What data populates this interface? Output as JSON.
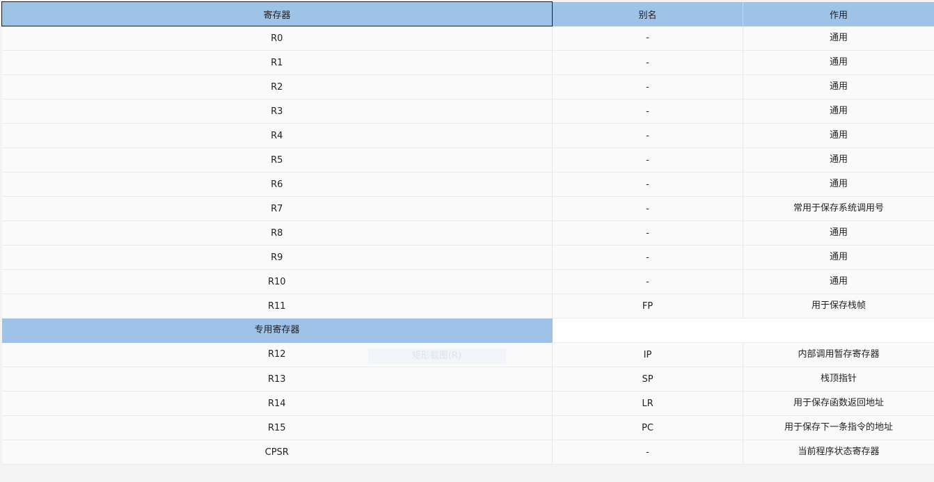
{
  "table": {
    "headers": {
      "register": "寄存器",
      "alias": "别名",
      "purpose": "作用"
    },
    "general_rows": [
      {
        "register": "R0",
        "alias": "-",
        "purpose": "通用"
      },
      {
        "register": "R1",
        "alias": "-",
        "purpose": "通用"
      },
      {
        "register": "R2",
        "alias": "-",
        "purpose": "通用"
      },
      {
        "register": "R3",
        "alias": "-",
        "purpose": "通用"
      },
      {
        "register": "R4",
        "alias": "-",
        "purpose": "通用"
      },
      {
        "register": "R5",
        "alias": "-",
        "purpose": "通用"
      },
      {
        "register": "R6",
        "alias": "-",
        "purpose": "通用"
      },
      {
        "register": "R7",
        "alias": "-",
        "purpose": "常用于保存系统调用号"
      },
      {
        "register": "R8",
        "alias": "-",
        "purpose": "通用"
      },
      {
        "register": "R9",
        "alias": "-",
        "purpose": "通用"
      },
      {
        "register": "R10",
        "alias": "-",
        "purpose": "通用"
      },
      {
        "register": "R11",
        "alias": "FP",
        "purpose": "用于保存栈帧"
      }
    ],
    "section_title": "专用寄存器",
    "special_rows": [
      {
        "register": "R12",
        "alias": "IP",
        "purpose": "内部调用暂存寄存器"
      },
      {
        "register": "R13",
        "alias": "SP",
        "purpose": "栈顶指针"
      },
      {
        "register": "R14",
        "alias": "LR",
        "purpose": "用于保存函数返回地址"
      },
      {
        "register": "R15",
        "alias": "PC",
        "purpose": "用于保存下一条指令的地址"
      },
      {
        "register": "CPSR",
        "alias": "-",
        "purpose": "当前程序状态寄存器"
      }
    ]
  },
  "overlay": {
    "ghost_tooltip": "矩形截图(R)"
  },
  "colors": {
    "header_bg": "#9fc2e7",
    "cell_bg": "#fafafb",
    "text": "#222222"
  }
}
